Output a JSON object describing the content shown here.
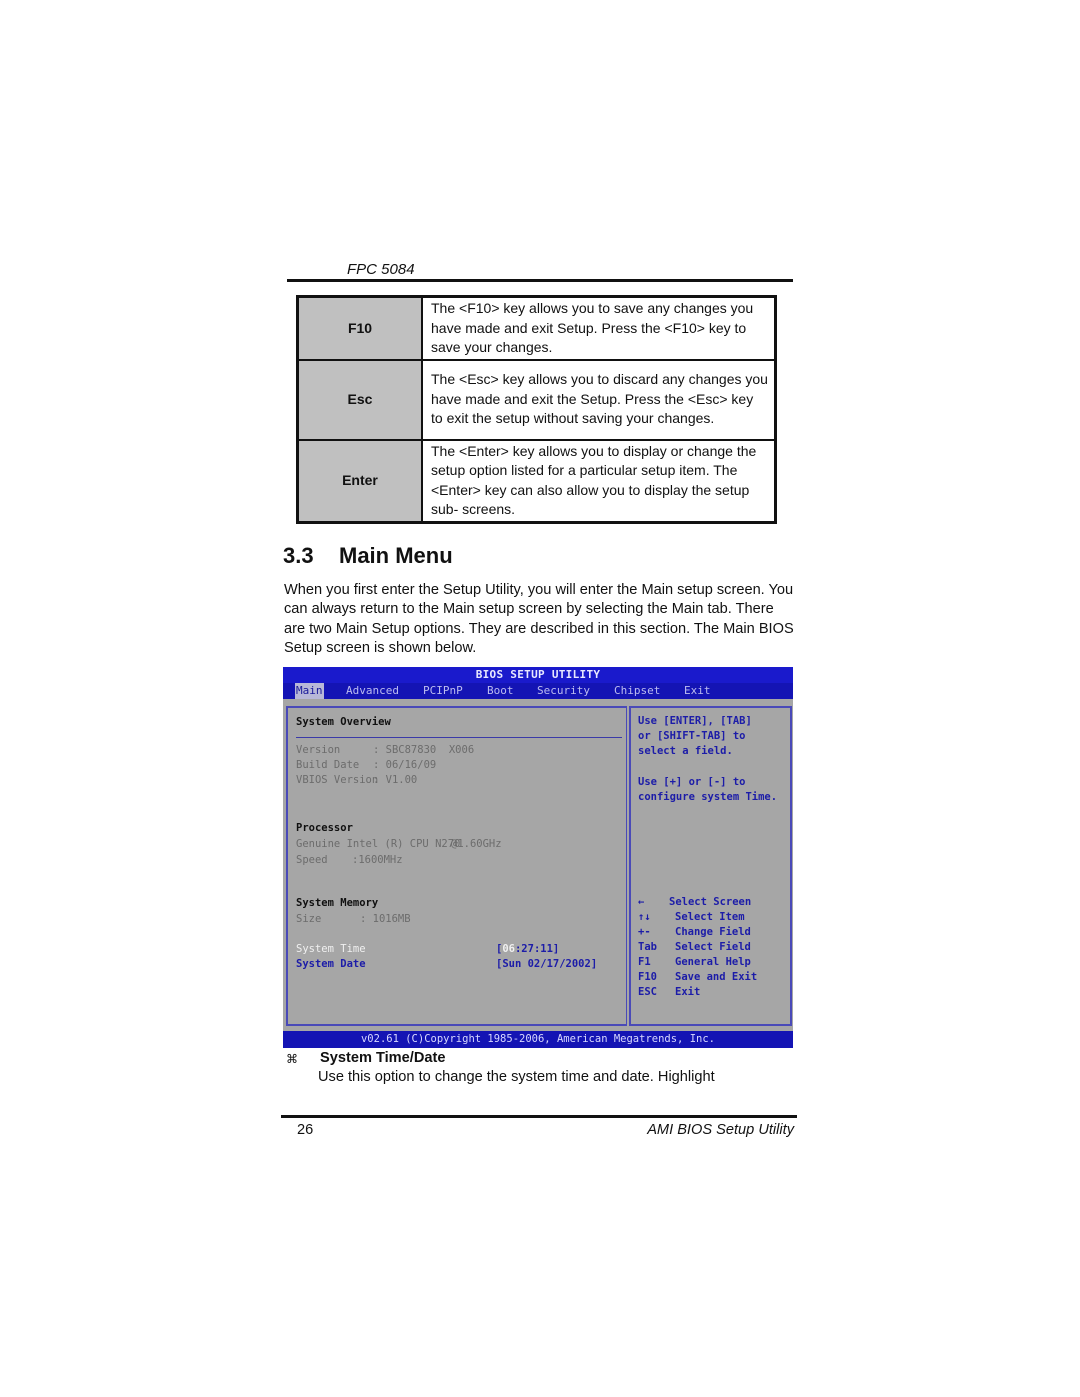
{
  "header": {
    "title": "FPC 5084"
  },
  "key_table": [
    {
      "key": "F10",
      "description": "The <F10> key allows you to save any changes you have made and exit Setup. Press the <F10> key to save your changes."
    },
    {
      "key": "Esc",
      "description": "The <Esc> key allows you to discard any changes you have made and exit the Setup. Press the <Esc> key to exit the setup without saving your changes."
    },
    {
      "key": "Enter",
      "description": "The <Enter> key allows you to display or change the setup option listed for a particular setup item. The <Enter> key can also allow you to display the setup sub- screens."
    }
  ],
  "section": {
    "number": "3.3",
    "title": "Main Menu",
    "intro": "When you first enter the Setup Utility, you will enter the Main setup screen. You can always return to the Main setup screen by selecting the Main tab. There are two Main Setup options. They are described in this section. The Main BIOS Setup screen is shown below."
  },
  "bios": {
    "title": "BIOS SETUP UTILITY",
    "tabs": [
      {
        "label": "Main",
        "active": true
      },
      {
        "label": "Advanced"
      },
      {
        "label": "PCIPnP"
      },
      {
        "label": "Boot"
      },
      {
        "label": "Security"
      },
      {
        "label": "Chipset"
      },
      {
        "label": "Exit"
      }
    ],
    "overview": {
      "heading": "System Overview",
      "version_label": "Version",
      "version_value": ": SBC87830  X006",
      "build_label": "Build Date",
      "build_value": ": 06/16/09",
      "vbios_label": "VBIOS Version",
      "vbios_value": ": V1.00"
    },
    "processor": {
      "heading": "Processor",
      "name": "Genuine Intel (R) CPU N270",
      "freq": "@1.60GHz",
      "speed_label": "Speed",
      "speed_value": ":1600MHz"
    },
    "memory": {
      "heading": "System Memory",
      "size_label": "Size",
      "size_value": ": 1016MB"
    },
    "system_time": {
      "label": "System Time",
      "open": "[",
      "highlight": "06",
      "rest": ":27:11]"
    },
    "system_date": {
      "label": "System Date",
      "value": "[Sun 02/17/2002]"
    },
    "help": [
      "Use [ENTER], [TAB]",
      "or [SHIFT-TAB] to",
      "select a field.",
      "",
      "Use [+] or [-] to",
      "configure system Time."
    ],
    "keys": [
      {
        "key": "←",
        "action": "Select Screen"
      },
      {
        "key": "↑↓",
        "action": "Select Item"
      },
      {
        "key": "+-",
        "action": "Change Field"
      },
      {
        "key": "Tab",
        "action": "Select Field"
      },
      {
        "key": "F1",
        "action": "General Help"
      },
      {
        "key": "F10",
        "action": "Save and Exit"
      },
      {
        "key": "ESC",
        "action": "Exit"
      }
    ],
    "footer": "v02.61 (C)Copyright 1985-2006, American Megatrends, Inc."
  },
  "option": {
    "bullet": "⌘",
    "title": "System Time/Date",
    "text": "Use this option to change the system time and date. Highlight"
  },
  "footer": {
    "page": "26",
    "title": "AMI BIOS Setup Utility"
  }
}
